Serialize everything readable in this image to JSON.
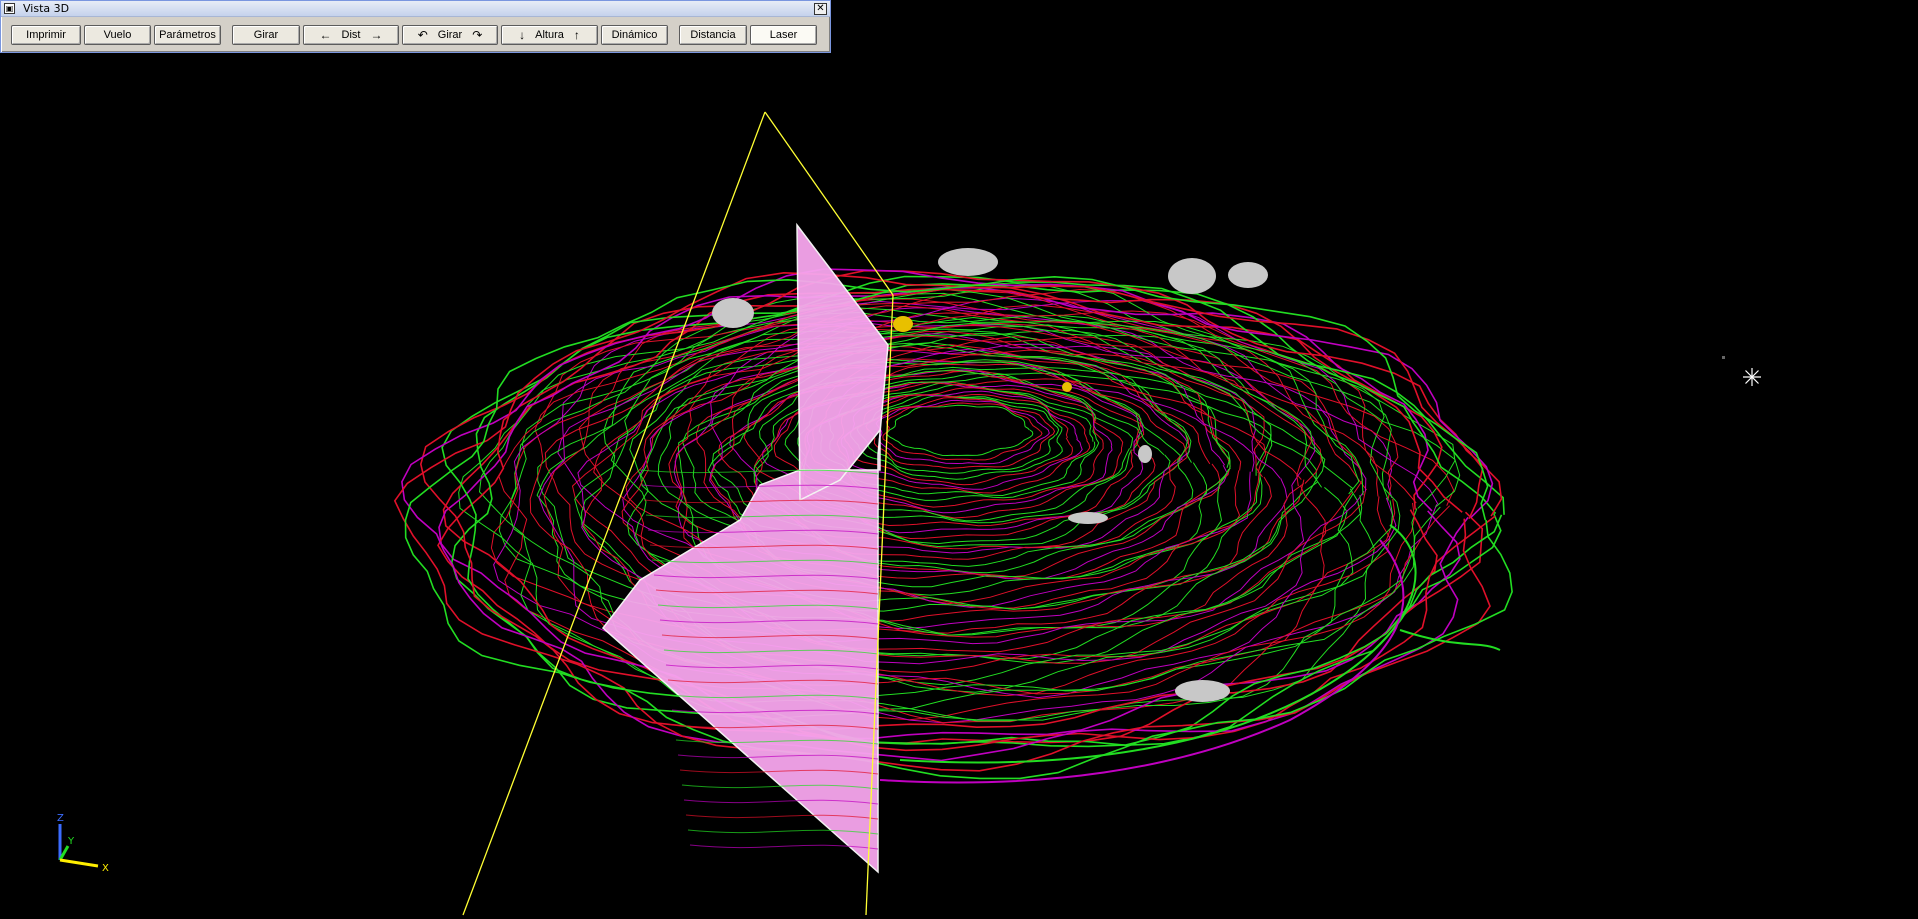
{
  "window": {
    "title": "Vista 3D",
    "close_glyph": "✕",
    "sys_glyph": "▣"
  },
  "toolbar": {
    "buttons": [
      {
        "label": "Imprimir"
      },
      {
        "label": "Vuelo"
      },
      {
        "label": "Parámetros"
      },
      {
        "label": "Girar"
      },
      {
        "label": "Dist",
        "left_icon": "←",
        "right_icon": "→"
      },
      {
        "label": "Girar",
        "left_icon": "↶",
        "right_icon": "↷"
      },
      {
        "label": "Altura",
        "left_icon": "↓",
        "right_icon": "↑"
      },
      {
        "label": "Dinámico"
      },
      {
        "label": "Distancia"
      },
      {
        "label": "Laser"
      }
    ]
  },
  "axes": {
    "z_label": "Z",
    "y_label": "Y",
    "x_label": "X"
  },
  "colors": {
    "background": "#000000",
    "contour_green": "#22dd22",
    "contour_red": "#e0102a",
    "contour_magenta": "#c000c0",
    "laser_plane": "#f7a6ee",
    "laser_outline": "#ffff33",
    "patch_grey": "#c8c8c8",
    "patch_yellow": "#e8c000"
  }
}
